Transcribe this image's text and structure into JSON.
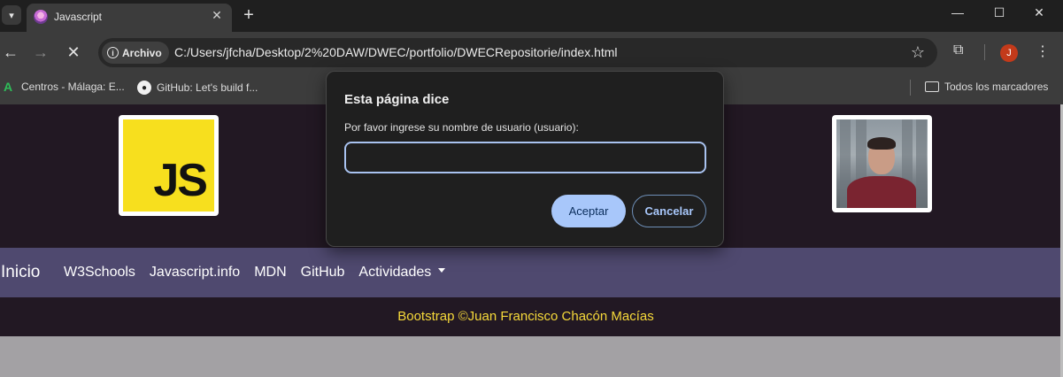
{
  "browser": {
    "tab": {
      "title": "Javascript",
      "close": "✕"
    },
    "new_tab": "+",
    "window_controls": {
      "minimize": "—",
      "maximize": "☐",
      "close": "✕"
    },
    "nav": {
      "back": "←",
      "forward": "→",
      "stop": "✕"
    },
    "site_chip_label": "Archivo",
    "url": "C:/Users/jfcha/Desktop/2%20DAW/DWEC/portfolio/DWECRepositorie/index.html",
    "bookmark_star": "☆",
    "extensions_icon": "⧉",
    "profile_initial": "J",
    "menu_icon": "⋮",
    "bookmarks": [
      {
        "label": "Centros - Málaga: E...",
        "icon": "andalucia-icon"
      },
      {
        "label": "GitHub: Let's build f...",
        "icon": "github-icon"
      }
    ],
    "all_bookmarks": "Todos los marcadores"
  },
  "page": {
    "logo_text": "JS",
    "navbar": {
      "brand": "Inicio",
      "links": [
        "W3Schools",
        "Javascript.info",
        "MDN",
        "GitHub",
        "Actividades"
      ]
    },
    "footer": "Bootstrap ©Juan Francisco Chacón Macías"
  },
  "dialog": {
    "title": "Esta página dice",
    "message": "Por favor ingrese su nombre de usuario (usuario):",
    "input_value": "",
    "ok_label": "Aceptar",
    "cancel_label": "Cancelar"
  },
  "colors": {
    "header_bg": "#221823",
    "navbar_bg": "#4f496f",
    "footer_text": "#f6d93a",
    "accent": "#a8c7fa"
  }
}
